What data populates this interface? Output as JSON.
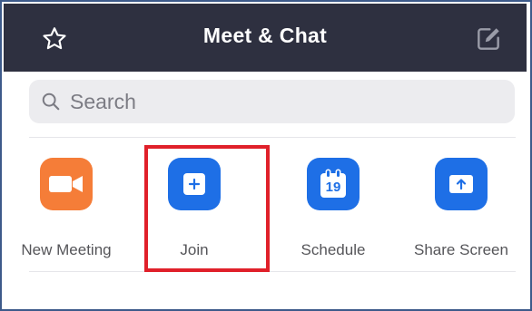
{
  "header": {
    "title": "Meet & Chat",
    "star_icon": "star-icon",
    "compose_icon": "compose-icon",
    "background": "#2e3040"
  },
  "search": {
    "placeholder": "Search",
    "icon": "search-icon"
  },
  "actions": [
    {
      "label": "New Meeting",
      "icon": "video-camera-icon",
      "color": "#f57d38"
    },
    {
      "label": "Join",
      "icon": "plus-icon",
      "color": "#1e6fe6"
    },
    {
      "label": "Schedule",
      "icon": "calendar-icon",
      "calendar_day": "19",
      "color": "#1e6fe6"
    },
    {
      "label": "Share Screen",
      "icon": "share-screen-icon",
      "color": "#1e6fe6"
    }
  ],
  "highlight": {
    "target": "Join",
    "color": "#e0202a"
  }
}
